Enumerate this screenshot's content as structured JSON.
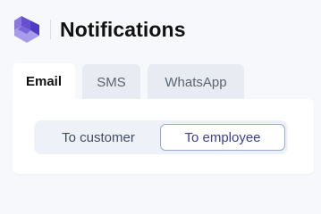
{
  "header": {
    "title": "Notifications",
    "logo_icon": "layered-hexagon-logo-icon",
    "logo_colors": [
      "#7c6ad8",
      "#5b45c9",
      "#a99bec"
    ]
  },
  "tabs": [
    {
      "label": "Email",
      "active": true
    },
    {
      "label": "SMS",
      "active": false
    },
    {
      "label": "WhatsApp",
      "active": false
    }
  ],
  "recipient_toggle": {
    "options": [
      {
        "label": "To customer",
        "selected": false
      },
      {
        "label": "To employee",
        "selected": true
      }
    ],
    "selected_border_color": "#9ea9ce",
    "selected_text_color": "#3d3f8f"
  }
}
